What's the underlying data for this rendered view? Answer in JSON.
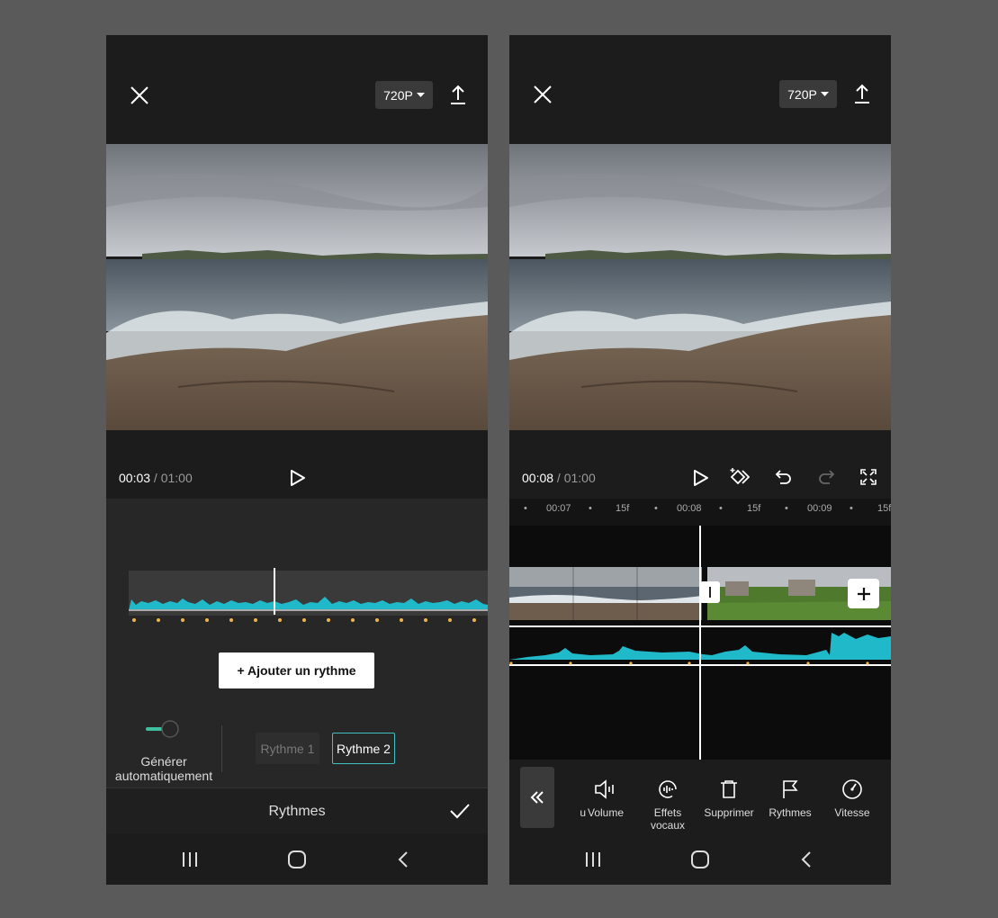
{
  "left": {
    "resolution": "720P",
    "time_current": "00:03",
    "time_sep": " / ",
    "time_total": "01:00",
    "add_rhythm_label": "+ Ajouter un rythme",
    "toggle_label_line1": "Générer",
    "toggle_label_line2": "automatiquement",
    "rhythm_options": [
      "Rythme 1",
      "Rythme 2"
    ],
    "selected_rhythm": "Rythme 2",
    "panel_title": "Rythmes"
  },
  "right": {
    "resolution": "720P",
    "time_current": "00:08",
    "time_sep": " / ",
    "time_total": "01:00",
    "ruler_labels": [
      "00:07",
      "15f",
      "00:08",
      "15f",
      "00:09",
      "15f"
    ],
    "tools": [
      {
        "label": "u",
        "icon": "partial-icon"
      },
      {
        "label": "Volume",
        "icon": "volume-icon"
      },
      {
        "label": "Effets vocaux",
        "icon": "voice-effects-icon"
      },
      {
        "label": "Supprimer",
        "icon": "delete-icon"
      },
      {
        "label": "Rythmes",
        "icon": "flag-icon"
      },
      {
        "label": "Vitesse",
        "icon": "speed-icon"
      }
    ]
  },
  "colors": {
    "accent_teal": "#1fb9c9",
    "beat_dot": "#f2b44a",
    "selected_chip_border": "#3fbfbf"
  }
}
